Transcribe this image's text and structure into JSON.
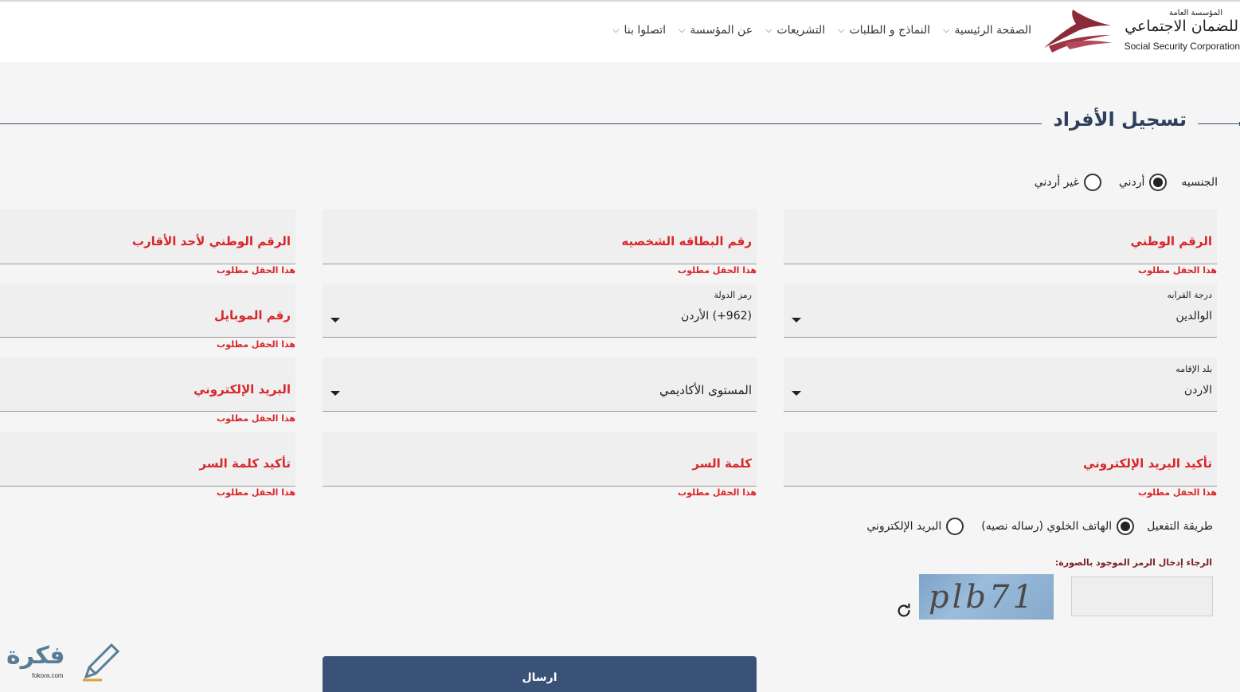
{
  "header": {
    "logo": {
      "small_text": "المؤسسة العامة",
      "main_text": "للضمان الاجتماعي",
      "english_text": "Social Security Corporation"
    },
    "nav": [
      {
        "label": "الصفحة الرئيسية",
        "icon": "chevron-down-icon"
      },
      {
        "label": "النماذج و الطلبات",
        "icon": "chevron-down-icon"
      },
      {
        "label": "التشريعات",
        "icon": "chevron-down-icon"
      },
      {
        "label": "عن المؤسسة",
        "icon": "chevron-down-icon"
      },
      {
        "label": "اتصلوا بنا",
        "icon": "chevron-down-icon"
      }
    ]
  },
  "page": {
    "title": "تسجيل الأفراد"
  },
  "nationality": {
    "label": "الجنسيه",
    "options": [
      {
        "label": "أردني",
        "selected": true
      },
      {
        "label": "غير أردني",
        "selected": false
      }
    ]
  },
  "fields": {
    "national_id": {
      "label": "الرقم الوطني",
      "error": "هذا الحقل مطلوب"
    },
    "id_card": {
      "label": "رقم البطاقه الشخصيه",
      "error": "هذا الحقل مطلوب"
    },
    "relative_id": {
      "label": "الرقم الوطني لأحد الأقارب",
      "error": "هذا الحقل مطلوب"
    },
    "relation": {
      "label": "درجة القرابه",
      "value": "الوالدين"
    },
    "country_code": {
      "label": "رمز الدولة",
      "value": "(962+) الأردن"
    },
    "mobile": {
      "label": "رقم الموبايل",
      "error": "هذا الحقل مطلوب"
    },
    "residence": {
      "label": "بلد الإقامه",
      "value": "الاردن"
    },
    "education": {
      "label": "المستوى الأكاديمي"
    },
    "email": {
      "label": "البريد الإلكتروني",
      "error": "هذا الحقل مطلوب"
    },
    "email_confirm": {
      "label": "تأكيد البريد الإلكتروني",
      "error": "هذا الحقل مطلوب"
    },
    "password": {
      "label": "كلمة السر",
      "error": "هذا الحقل مطلوب"
    },
    "password_confirm": {
      "label": "تأكيد كلمة السر",
      "error": "هذا الحقل مطلوب"
    }
  },
  "activation": {
    "label": "طريقة التفعيل",
    "options": [
      {
        "label": "الهاتف الخلوي (رساله نصيه)",
        "selected": true
      },
      {
        "label": "البريد الإلكتروني",
        "selected": false
      }
    ]
  },
  "captcha": {
    "label": "الرجاء إدخال الرمز الموجود بالصورة:",
    "image_text": "plb71",
    "refresh_icon": "refresh-icon"
  },
  "submit": {
    "label": "ارسال"
  },
  "watermark": {
    "text": "فكرة",
    "sub": "fokora.com"
  },
  "colors": {
    "accent": "#3b5278",
    "error": "#d9262b",
    "title": "#2e3f5c"
  }
}
